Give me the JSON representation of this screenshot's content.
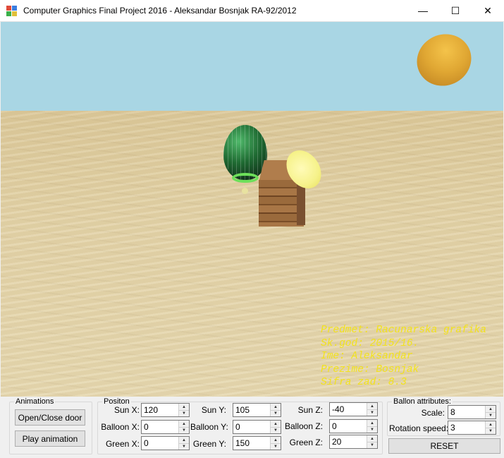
{
  "window": {
    "title": "Computer Graphics Final Project 2016 - Aleksandar Bosnjak RA-92/2012",
    "minimize_glyph": "—",
    "maximize_glyph": "☐",
    "close_glyph": "✕"
  },
  "overlay": {
    "color": "#f2e21e",
    "lines": [
      "Predmet: Racunarska grafika",
      "Sk.god: 2015/16.",
      "Ime: Aleksandar",
      "Prezime: Bosnjak",
      "Sifra zad: 8.3"
    ]
  },
  "animations": {
    "legend": "Animations",
    "open_close_label": "Open/Close door",
    "play_label": "Play animation"
  },
  "position": {
    "legend": "Positon",
    "sun_x": {
      "label": "Sun X:",
      "value": "120"
    },
    "balloon_x": {
      "label": "Balloon X:",
      "value": "0"
    },
    "green_x": {
      "label": "Green X:",
      "value": "0"
    },
    "sun_y": {
      "label": "Sun Y:",
      "value": "105"
    },
    "balloon_y": {
      "label": "Balloon Y:",
      "value": "0"
    },
    "green_y": {
      "label": "Green Y:",
      "value": "150"
    },
    "sun_z": {
      "label": "Sun Z:",
      "value": "-40"
    },
    "balloon_z": {
      "label": "Balloon Z:",
      "value": "0"
    },
    "green_z": {
      "label": "Green Z:",
      "value": "20"
    }
  },
  "balloon_attributes": {
    "legend": "Ballon attributes:",
    "scale": {
      "label": "Scale:",
      "value": "8"
    },
    "rotation_speed": {
      "label": "Rotation speed:",
      "value": "3"
    },
    "reset_label": "RESET"
  }
}
